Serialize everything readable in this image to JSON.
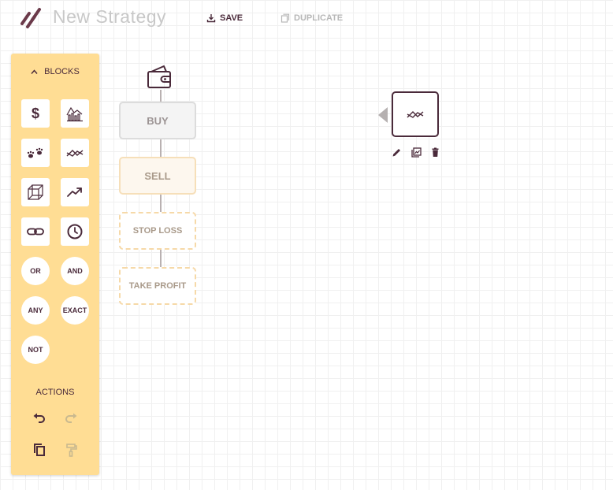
{
  "header": {
    "title": "New Strategy",
    "save_label": "SAVE",
    "duplicate_label": "DUPLICATE",
    "logo_icon": "chain-link-logo-icon"
  },
  "sidebar": {
    "blocks_label": "BLOCKS",
    "blocks": [
      {
        "icon": "dollar-icon"
      },
      {
        "icon": "bar-line-chart-icon"
      },
      {
        "icon": "paw-prints-icon"
      },
      {
        "icon": "crossing-lines-icon"
      },
      {
        "icon": "cube-icon"
      },
      {
        "icon": "trend-up-icon"
      },
      {
        "icon": "link-icon"
      },
      {
        "icon": "clock-icon"
      }
    ],
    "logic": [
      {
        "label": "OR"
      },
      {
        "label": "AND"
      },
      {
        "label": "ANY"
      },
      {
        "label": "EXACT"
      },
      {
        "label": "NOT"
      }
    ],
    "actions_label": "ACTIONS",
    "actions": [
      {
        "icon": "undo-icon"
      },
      {
        "icon": "redo-icon"
      },
      {
        "icon": "copy-icon"
      },
      {
        "icon": "paint-roller-icon"
      }
    ]
  },
  "flow": {
    "start_icon": "wallet-icon",
    "nodes": [
      {
        "label": "BUY"
      },
      {
        "label": "SELL"
      },
      {
        "label": "STOP LOSS"
      },
      {
        "label": "TAKE PROFIT"
      }
    ]
  },
  "floating_block": {
    "icon": "crossing-lines-icon",
    "tools": [
      "edit-icon",
      "chart-icon",
      "delete-icon"
    ]
  },
  "colors": {
    "accent": "#4a2a3a",
    "sidebar": "#ffdd94",
    "muted": "#c8c8c8"
  }
}
